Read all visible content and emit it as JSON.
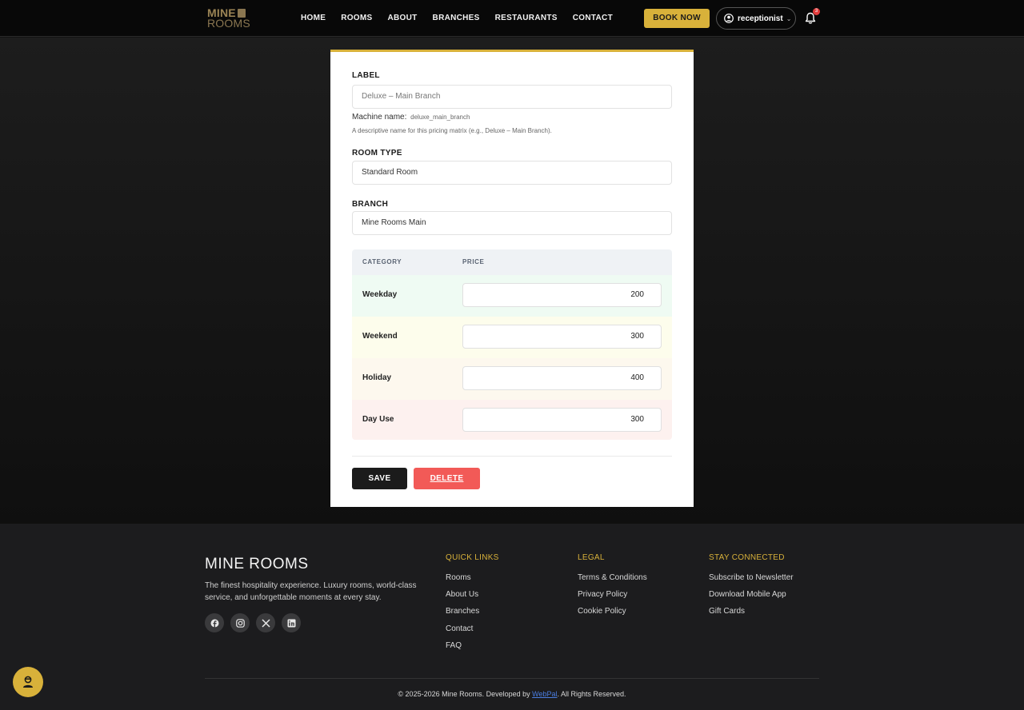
{
  "header": {
    "logo_line1": "MINE",
    "logo_line2": "ROOMS",
    "nav": [
      "HOME",
      "ROOMS",
      "ABOUT",
      "BRANCHES",
      "RESTAURANTS",
      "CONTACT"
    ],
    "book_now": "BOOK NOW",
    "user_name": "receptionist",
    "notification_count": "3"
  },
  "form": {
    "label_title": "LABEL",
    "label_value": "Deluxe – Main Branch",
    "machine_name_label": "Machine name:",
    "machine_name_value": "deluxe_main_branch",
    "label_help": "A descriptive name for this pricing matrix (e.g., Deluxe – Main Branch).",
    "room_type_title": "ROOM TYPE",
    "room_type_value": "Standard Room",
    "branch_title": "BRANCH",
    "branch_value": "Mine Rooms Main",
    "table": {
      "col_category": "CATEGORY",
      "col_price": "PRICE",
      "rows": [
        {
          "category": "Weekday",
          "price": "200",
          "bg": "#effbf3"
        },
        {
          "category": "Weekend",
          "price": "300",
          "bg": "#fdfdec"
        },
        {
          "category": "Holiday",
          "price": "400",
          "bg": "#fdf8ee"
        },
        {
          "category": "Day Use",
          "price": "300",
          "bg": "#fdf1ef"
        }
      ]
    },
    "save": "SAVE",
    "delete": "DELETE"
  },
  "footer": {
    "brand": "MINE ROOMS",
    "tagline": "The finest hospitality experience. Luxury rooms, world-class service, and unforgettable moments at every stay.",
    "quick_links_title": "QUICK LINKS",
    "quick_links": [
      "Rooms",
      "About Us",
      "Branches",
      "Contact",
      "FAQ"
    ],
    "legal_title": "LEGAL",
    "legal_links": [
      "Terms & Conditions",
      "Privacy Policy",
      "Cookie Policy"
    ],
    "stay_title": "STAY CONNECTED",
    "stay_links": [
      "Subscribe to Newsletter",
      "Download Mobile App",
      "Gift Cards"
    ],
    "copyright_prefix": "© 2025-2026 Mine Rooms. Developed by ",
    "developer": "WebPal",
    "copyright_suffix": ". All Rights Reserved."
  },
  "colors": {
    "accent": "#d8b13a",
    "danger": "#f25a57",
    "dark": "#1b1b1b"
  }
}
